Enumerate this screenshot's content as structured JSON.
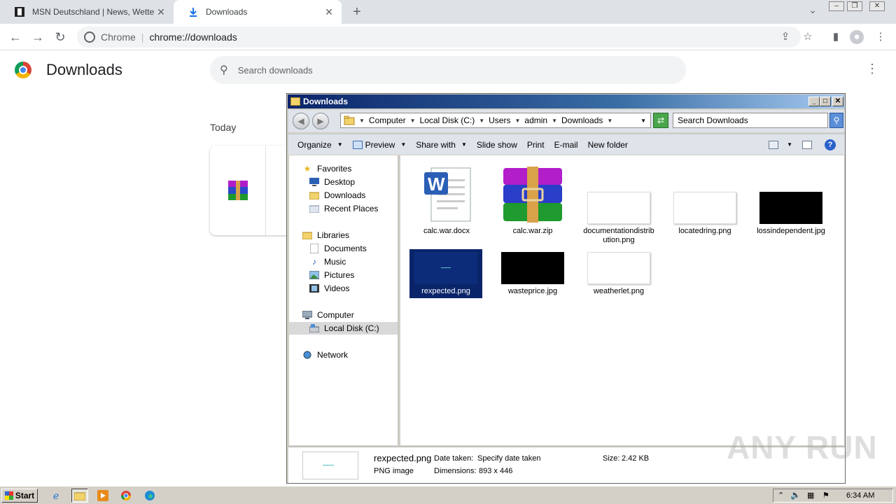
{
  "browser": {
    "tabs": [
      {
        "title": "MSN Deutschland | News, Wetter, Sport",
        "close": "✕"
      },
      {
        "title": "Downloads",
        "close": "✕"
      }
    ],
    "new_tab": "+",
    "omnibox": {
      "site": "Chrome",
      "url": "chrome://downloads"
    }
  },
  "downloads_page": {
    "title": "Downloads",
    "search_placeholder": "Search downloads",
    "section": "Today"
  },
  "explorer": {
    "title": "Downloads",
    "breadcrumbs": [
      "Computer",
      "Local Disk (C:)",
      "Users",
      "admin",
      "Downloads"
    ],
    "search_placeholder": "Search Downloads",
    "commands": [
      "Organize",
      "Preview",
      "Share with",
      "Slide show",
      "Print",
      "E-mail",
      "New folder"
    ],
    "nav": {
      "favorites": "Favorites",
      "desktop": "Desktop",
      "downloads": "Downloads",
      "recent": "Recent Places",
      "libraries": "Libraries",
      "documents": "Documents",
      "music": "Music",
      "pictures": "Pictures",
      "videos": "Videos",
      "computer": "Computer",
      "local_disk": "Local Disk (C:)",
      "network": "Network"
    },
    "files": [
      {
        "name": "calc.war.docx"
      },
      {
        "name": "calc.war.zip"
      },
      {
        "name": "documentationdistribution.png"
      },
      {
        "name": "locatedring.png"
      },
      {
        "name": "lossindependent.jpg"
      },
      {
        "name": "rexpected.png"
      },
      {
        "name": "wasteprice.jpg"
      },
      {
        "name": "weatherlet.png"
      }
    ],
    "details": {
      "filename": "rexpected.png",
      "filetype": "PNG image",
      "date_label": "Date taken:",
      "date_value": "Specify date taken",
      "dims_label": "Dimensions:",
      "dims_value": "893 x 446",
      "size_label": "Size:",
      "size_value": "2.42 KB"
    }
  },
  "taskbar": {
    "start": "Start",
    "clock": "6:34 AM"
  },
  "watermark": "ANY RUN"
}
